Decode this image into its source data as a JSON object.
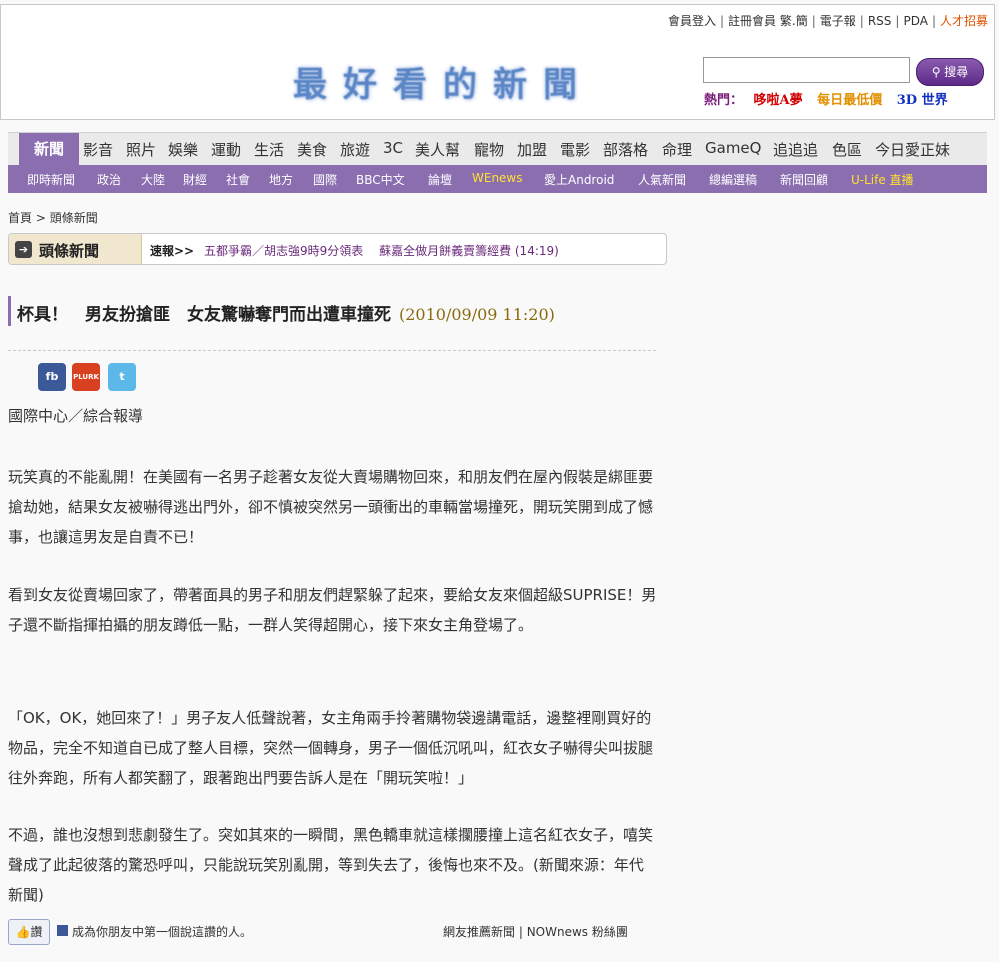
{
  "header": {
    "top_links": [
      "會員登入",
      "註冊會員",
      "繁.簡",
      "電子報",
      "RSS",
      "PDA",
      "人才招募"
    ],
    "logo": "最好看的新聞",
    "search_button": "搜尋",
    "search_placeholder": "",
    "hot_label": "熱門：",
    "hot_links": [
      "哆啦A夢",
      "最低價",
      "3D 世界"
    ]
  },
  "nav_primary": [
    "新聞",
    "影音",
    "照片",
    "娛樂",
    "運動",
    "生活",
    "美食",
    "旅遊",
    "3C",
    "美人幫",
    "寵物",
    "加盟",
    "電影",
    "部落格",
    "命理",
    "GameQ",
    "追追追",
    "色區",
    "今日愛正妹"
  ],
  "nav_secondary": [
    "即時新聞",
    "政治",
    "大陸",
    "財經",
    "社會",
    "地方",
    "國際",
    "BBC中文",
    "論壇",
    "WEnews",
    "愛上Android",
    "人氣新聞",
    "總編選稿",
    "新聞回顧",
    "U-Life 直播"
  ],
  "breadcrumb": [
    "首頁",
    "頭條新聞"
  ],
  "section_tab": "頭條新聞",
  "flash": {
    "label": "速報>>",
    "items": [
      "五都爭霸／胡志強9時9分領表",
      "蘇嘉全做月餅義賣籌經費 (14:19)"
    ]
  },
  "article": {
    "title": "杯具！　男友扮搶匪　女友驚嚇奪門而出遭車撞死",
    "date": "(2010/09/09 11:20)",
    "share": [
      "fb",
      "PLURK",
      "t"
    ],
    "byline": "國際中心／綜合報導",
    "paragraphs": [
      "玩笑真的不能亂開！在美國有一名男子趁著女友從大賣場購物回來，和朋友們在屋內假裝是綁匪要搶劫她，結果女友被嚇得逃出門外，卻不慎被突然另一頭衝出的車輛當場撞死，開玩笑開到成了憾事，也讓這男友是自責不已！",
      "看到女友從賣場回家了，帶著面具的男子和朋友們趕緊躲了起來，要給女友來個超級SUPRISE！男子還不斷指揮拍攝的朋友蹲低一點，一群人笑得超開心，接下來女主角登場了。",
      "「OK，OK，她回來了！」男子友人低聲說著，女主角兩手拎著購物袋邊講電話，邊整裡剛買好的物品，完全不知道自已成了整人目標，突然一個轉身，男子一個低沉吼叫，紅衣女子嚇得尖叫拔腿往外奔跑，所有人都笑翻了，跟著跑出門要告訴人是在「開玩笑啦！」",
      "不過，誰也沒想到悲劇發生了。突如其來的一瞬間，黑色轎車就這樣攔腰撞上這名紅衣女子，嘻笑聲成了此起彼落的驚恐呼叫，只能說玩笑別亂開，等到失去了，後悔也來不及。(新聞來源：年代新聞)"
    ]
  },
  "footer": {
    "like_button": "讚",
    "like_text": "成為你朋友中第一個說這讚的人。",
    "links": [
      "網友推薦新聞",
      "NOWnews 粉絲團"
    ]
  },
  "colors": {
    "accent": "#8a6eb0",
    "hot_red": "#d00000",
    "hot_orange": "#e09000",
    "hot_blue": "#1030c0"
  }
}
